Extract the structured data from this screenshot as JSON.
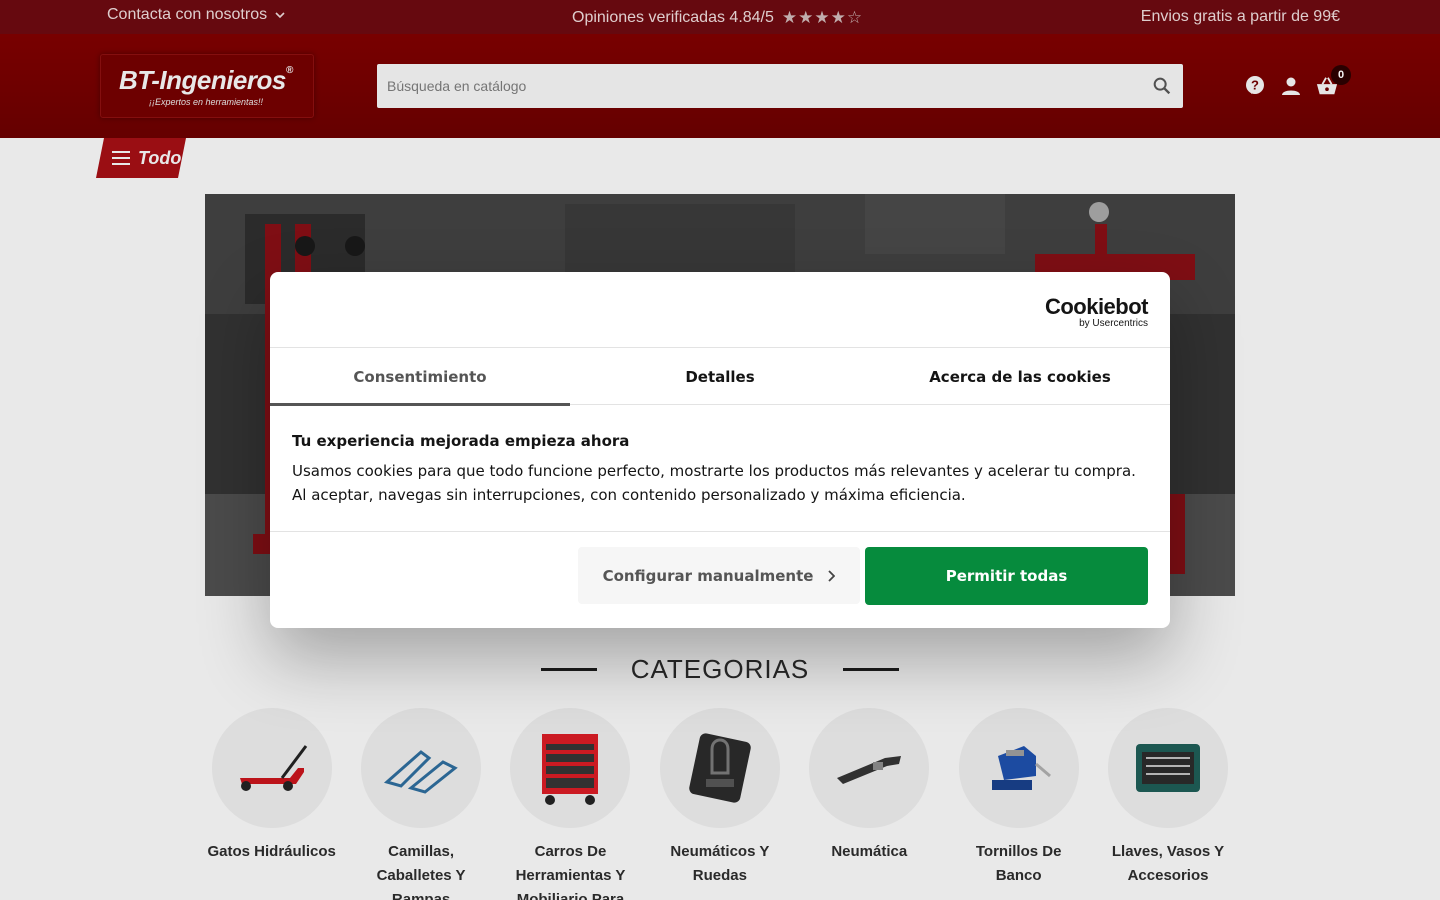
{
  "topbar": {
    "contact_label": "Contacta con nosotros",
    "reviews_label": "Opiniones verificadas 4.84/5",
    "rating_stars": "★★★★☆",
    "rating": 4.84,
    "shipping_label": "Envios gratis a partir de 99€"
  },
  "header": {
    "logo_brand": "BT-Ingenieros",
    "logo_reg": "®",
    "logo_tagline": "¡¡Expertos en herramientas!!",
    "search_placeholder": "Búsqueda en catálogo",
    "cart_count": "0"
  },
  "nav": {
    "menu_label": "Todo"
  },
  "categories": {
    "title": "CATEGORIAS",
    "items": [
      {
        "label": "Gatos Hidráulicos"
      },
      {
        "label": "Camillas, Caballetes Y Rampas"
      },
      {
        "label": "Carros De Herramientas Y Mobiliario Para"
      },
      {
        "label": "Neumáticos Y Ruedas"
      },
      {
        "label": "Neumática"
      },
      {
        "label": "Tornillos De Banco"
      },
      {
        "label": "Llaves, Vasos Y Accesorios"
      }
    ]
  },
  "cookie_modal": {
    "brand": "Cookiebot",
    "brand_sub": "by Usercentrics",
    "tabs": [
      {
        "label": "Consentimiento",
        "active": true
      },
      {
        "label": "Detalles",
        "active": false
      },
      {
        "label": "Acerca de las cookies",
        "active": false
      }
    ],
    "title": "Tu experiencia mejorada empieza ahora",
    "body": "Usamos cookies para que todo funcione perfecto, mostrarte los productos más relevantes y acelerar tu compra. Al aceptar, navegas sin interrupciones, con contenido personalizado y máxima eficiencia.",
    "configure_label": "Configurar manualmente",
    "allow_label": "Permitir todas"
  },
  "colors": {
    "topbar": "#6b0a10",
    "header": "#720000",
    "accent": "#a10f14",
    "allow_button": "#068b3d"
  }
}
